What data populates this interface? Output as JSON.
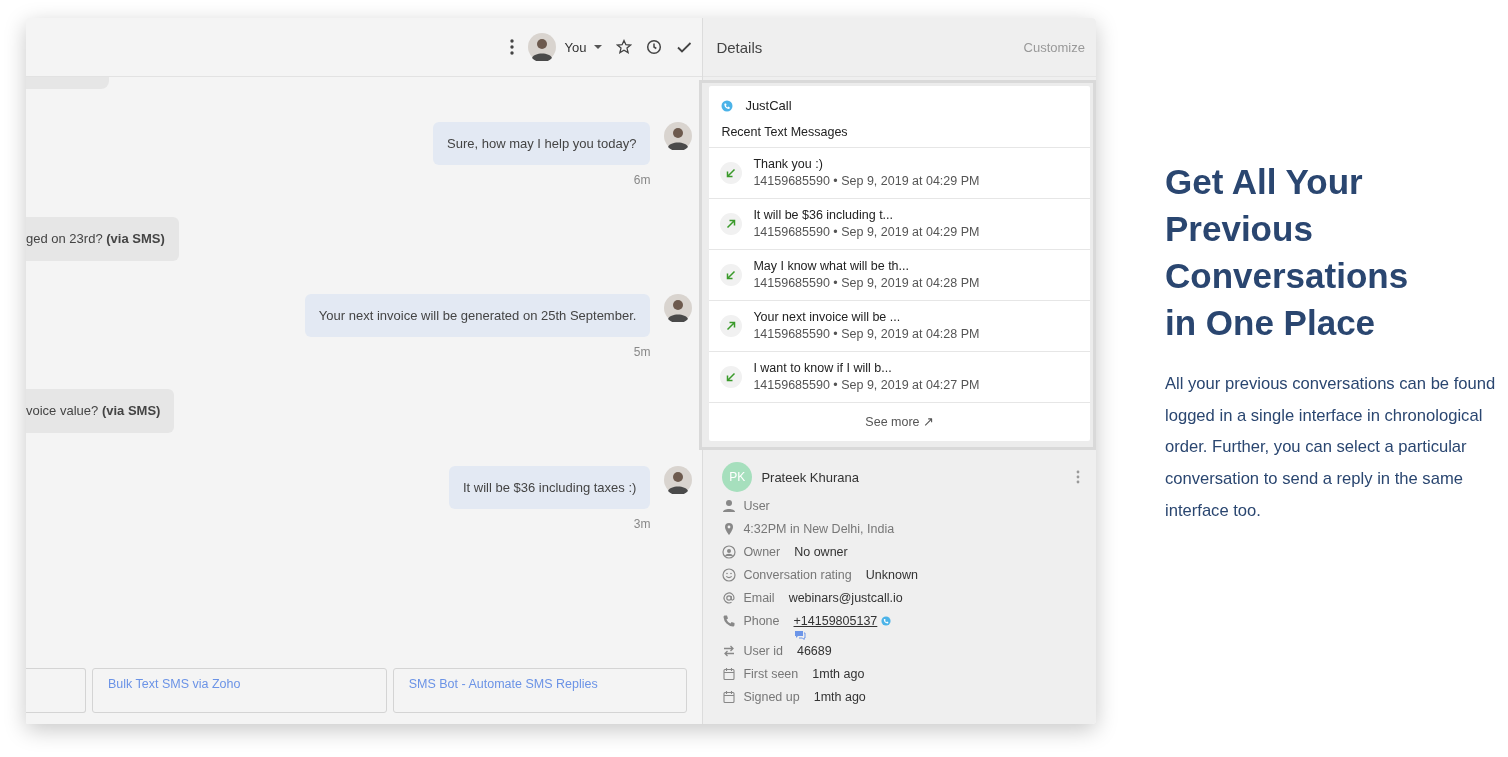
{
  "chat": {
    "header": {
      "assignee": "You"
    },
    "messages": [
      {
        "kind": "outgoing",
        "text": "Sure, how may I help you today?",
        "time": "6m"
      },
      {
        "kind": "incoming",
        "text": "ged on 23rd? **(via SMS)**"
      },
      {
        "kind": "outgoing",
        "text": "Your next invoice will be generated on 25th September.",
        "time": "5m"
      },
      {
        "kind": "incoming",
        "text": "voice value? **(via SMS)**"
      },
      {
        "kind": "outgoing",
        "text": "It will be $36 including taxes :)",
        "time": "3m"
      }
    ],
    "quick_replies": [
      {
        "kind": "cut"
      },
      {
        "kind": "full",
        "label": "Bulk Text SMS via Zoho"
      },
      {
        "kind": "full",
        "label": "SMS Bot - Automate SMS Replies"
      }
    ]
  },
  "details": {
    "title": "Details",
    "action": "Customize",
    "app": {
      "name": "JustCall",
      "section_title": "Recent Text Messages",
      "messages": [
        {
          "kind": "incoming",
          "text": "Thank you :)",
          "meta": "14159685590 • Sep 9, 2019 at 04:29 PM"
        },
        {
          "kind": "outgoing",
          "text": "It will be $36 including t...",
          "meta": "14159685590 • Sep 9, 2019 at 04:29 PM"
        },
        {
          "kind": "incoming",
          "text": "May I know what will be th...",
          "meta": "14159685590 • Sep 9, 2019 at 04:28 PM"
        },
        {
          "kind": "outgoing",
          "text": "Your next invoice will be ...",
          "meta": "14159685590 • Sep 9, 2019 at 04:28 PM"
        },
        {
          "kind": "incoming",
          "text": "I want to know if I will b...",
          "meta": "14159685590 • Sep 9, 2019 at 04:27 PM"
        }
      ],
      "see_more": "See more ↗"
    },
    "contact": {
      "initials": "PK",
      "name": "Prateek Khurana",
      "attributes": [
        {
          "kind": "user",
          "label": "User"
        },
        {
          "kind": "location",
          "label": "4:32PM in New Delhi, India"
        },
        {
          "kind": "owner",
          "label": "Owner",
          "value": "No owner"
        },
        {
          "kind": "rating",
          "label": "Conversation rating",
          "value": "Unknown"
        },
        {
          "kind": "email",
          "label": "Email",
          "value": "webinars@justcall.io"
        },
        {
          "kind": "phone",
          "label": "Phone",
          "value": "+14159805137"
        },
        {
          "kind": "user_id",
          "label": "User id",
          "value": "46689"
        },
        {
          "kind": "calendar",
          "label": "First seen",
          "value": "1mth ago"
        },
        {
          "kind": "calendar",
          "label": "Signed up",
          "value": "1mth ago"
        }
      ]
    }
  },
  "promo": {
    "heading_lines": [
      "Get All Your",
      "Previous",
      "Conversations",
      "in One Place"
    ],
    "body": "All your previous conversations can be found logged in a single interface in chronological order. Further, you can select a particular conversation to send a reply in the same interface too."
  }
}
